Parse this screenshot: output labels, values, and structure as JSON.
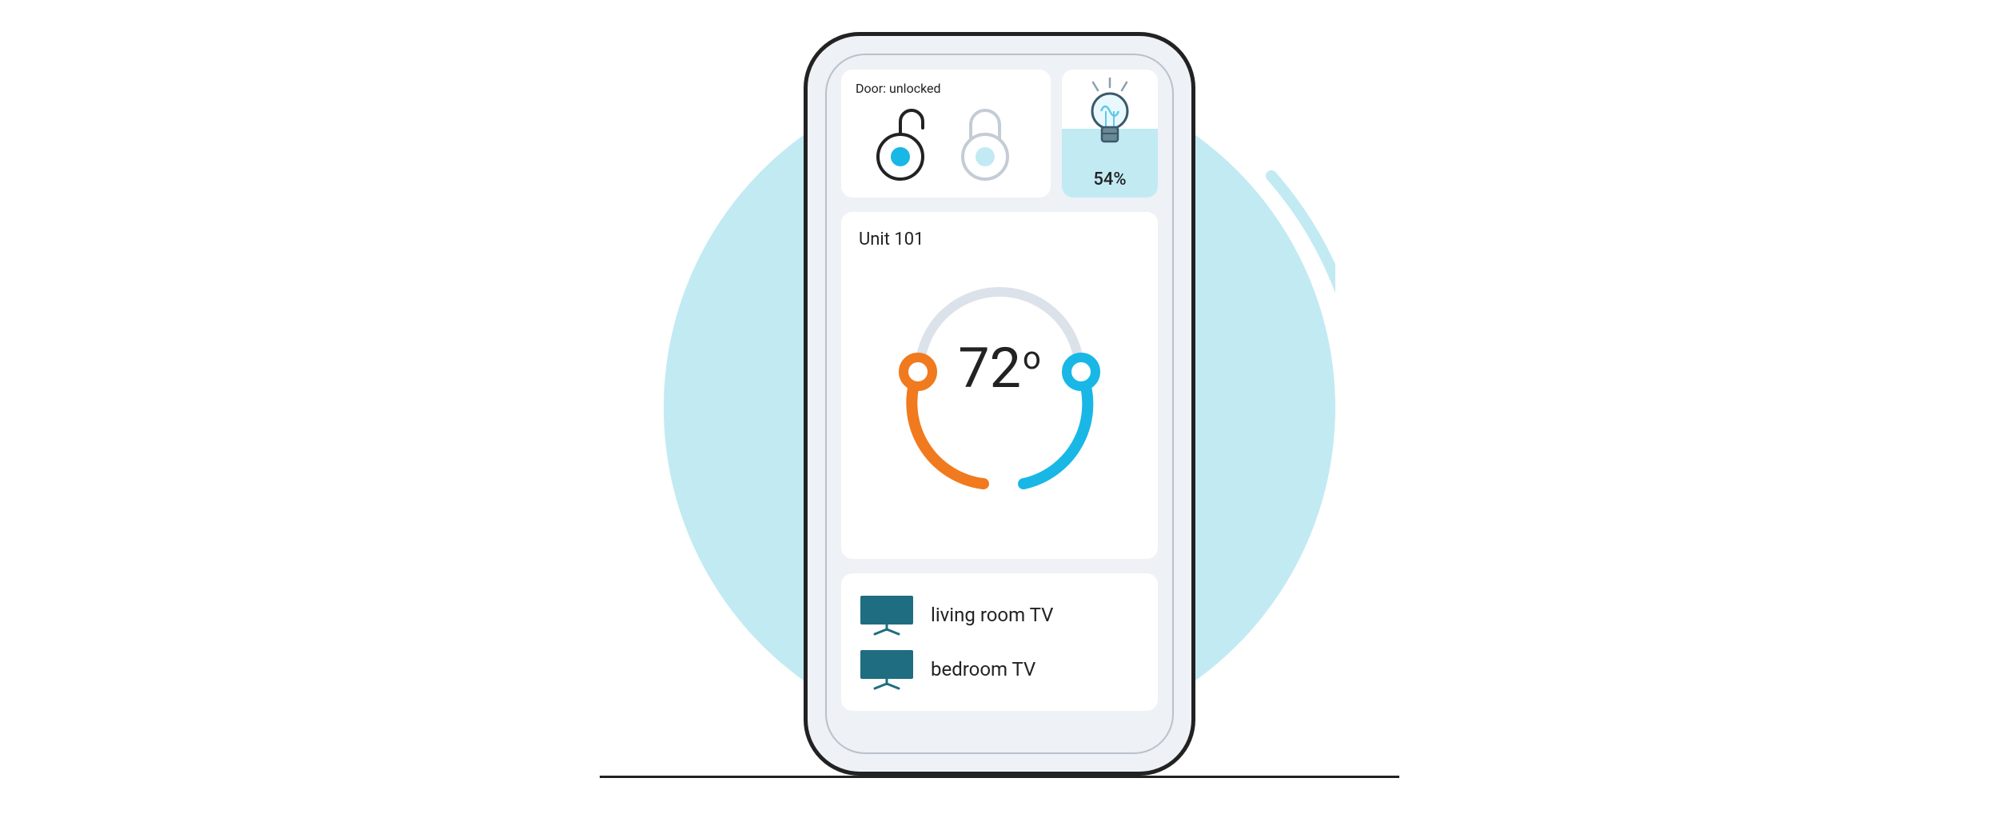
{
  "door": {
    "label": "Door: unlocked"
  },
  "light": {
    "percent_label": "54%",
    "percent_value": 54
  },
  "thermostat": {
    "unit_label": "Unit 101",
    "temperature": "72"
  },
  "tvs": [
    {
      "label": "living room TV"
    },
    {
      "label": "bedroom TV"
    }
  ],
  "colors": {
    "accent_blue": "#18b7e6",
    "accent_orange": "#f07a1d",
    "teal": "#1f6d80",
    "bg_circle": "#c2eaf3",
    "panel": "#eef1f5"
  }
}
